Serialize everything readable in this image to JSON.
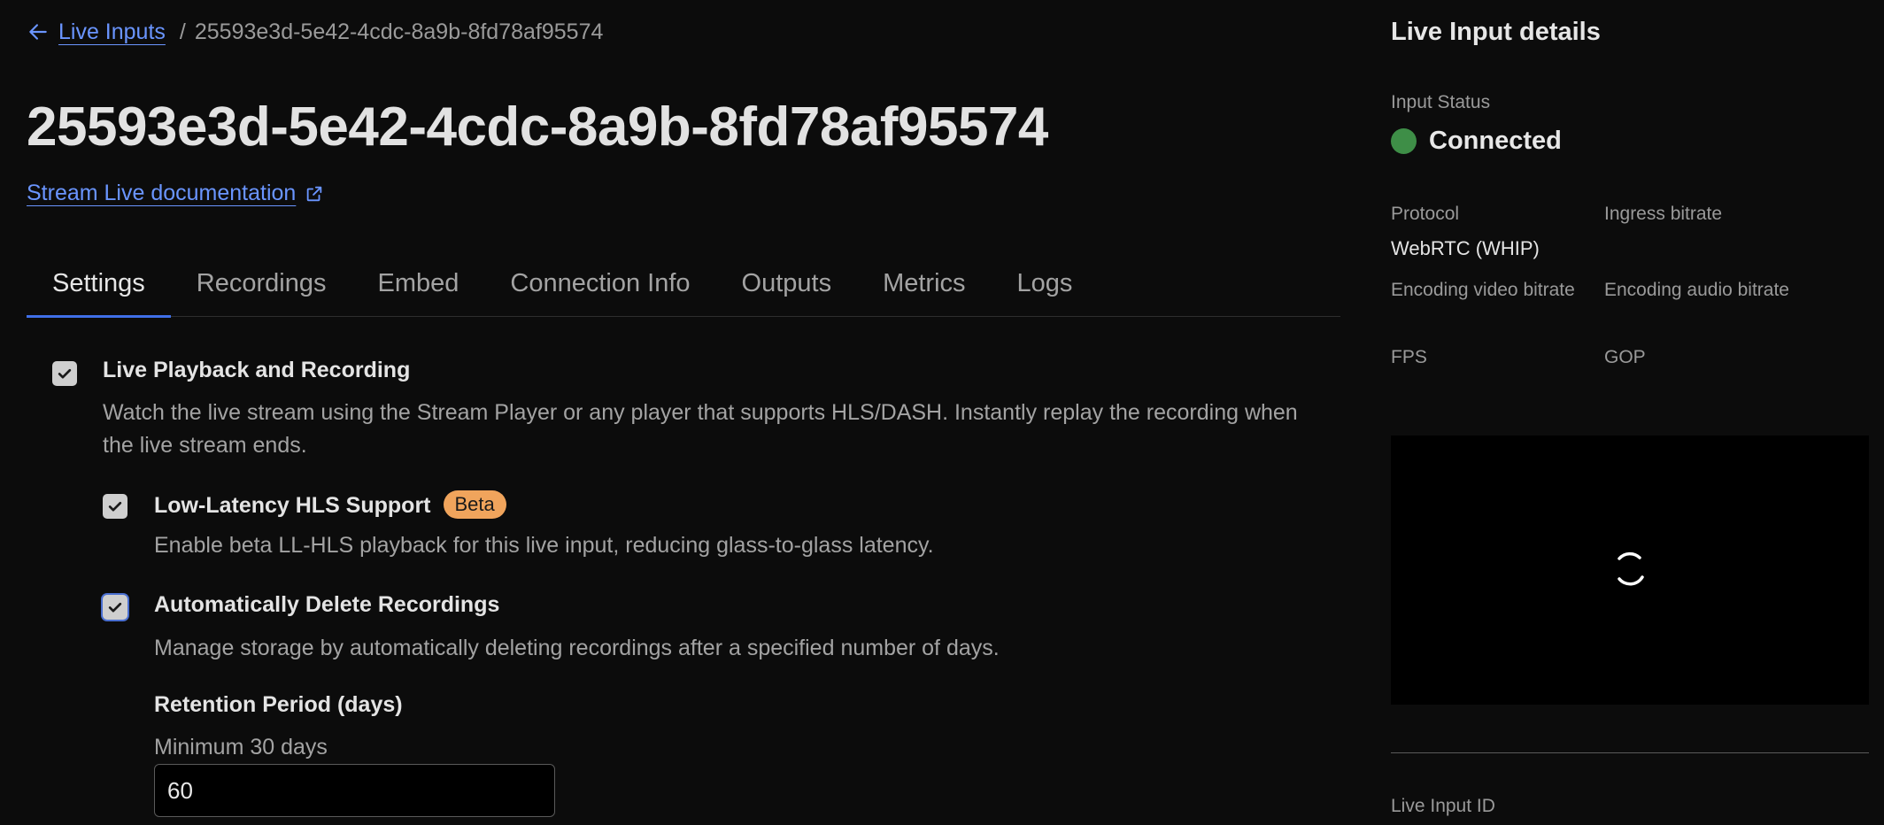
{
  "breadcrumb": {
    "back_label": "Live Inputs",
    "separator": "/",
    "current": "25593e3d-5e42-4cdc-8a9b-8fd78af95574"
  },
  "title": "25593e3d-5e42-4cdc-8a9b-8fd78af95574",
  "doc_link": "Stream Live documentation",
  "tabs": [
    {
      "label": "Settings",
      "active": true
    },
    {
      "label": "Recordings",
      "active": false
    },
    {
      "label": "Embed",
      "active": false
    },
    {
      "label": "Connection Info",
      "active": false
    },
    {
      "label": "Outputs",
      "active": false
    },
    {
      "label": "Metrics",
      "active": false
    },
    {
      "label": "Logs",
      "active": false
    }
  ],
  "settings": {
    "playback": {
      "label": "Live Playback and Recording",
      "checked": true,
      "description": "Watch the live stream using the Stream Player or any player that supports HLS/DASH. Instantly replay the recording when the live stream ends."
    },
    "llhls": {
      "label": "Low-Latency HLS Support",
      "badge": "Beta",
      "checked": true,
      "description": "Enable beta LL-HLS playback for this live input, reducing glass-to-glass latency."
    },
    "auto_delete": {
      "label": "Automatically Delete Recordings",
      "checked": true,
      "description": "Manage storage by automatically deleting recordings after a specified number of days."
    },
    "retention": {
      "label": "Retention Period (days)",
      "hint": "Minimum 30 days",
      "value": "60"
    }
  },
  "details": {
    "title": "Live Input details",
    "status_label": "Input Status",
    "status_value": "Connected",
    "protocol_label": "Protocol",
    "protocol_value": "WebRTC (WHIP)",
    "ingress_label": "Ingress bitrate",
    "enc_video_label": "Encoding video bitrate",
    "enc_audio_label": "Encoding audio bitrate",
    "fps_label": "FPS",
    "gop_label": "GOP",
    "id_label": "Live Input ID"
  },
  "colors": {
    "accent": "#3f6fe8",
    "link": "#6a95ff",
    "status_connected": "#3e8e47",
    "badge": "#f0a45c",
    "background": "#0c0c0c"
  },
  "icons": {
    "back": "arrow-left-icon",
    "external": "external-link-icon",
    "check": "check-icon",
    "spinner": "loading-spinner-icon"
  }
}
